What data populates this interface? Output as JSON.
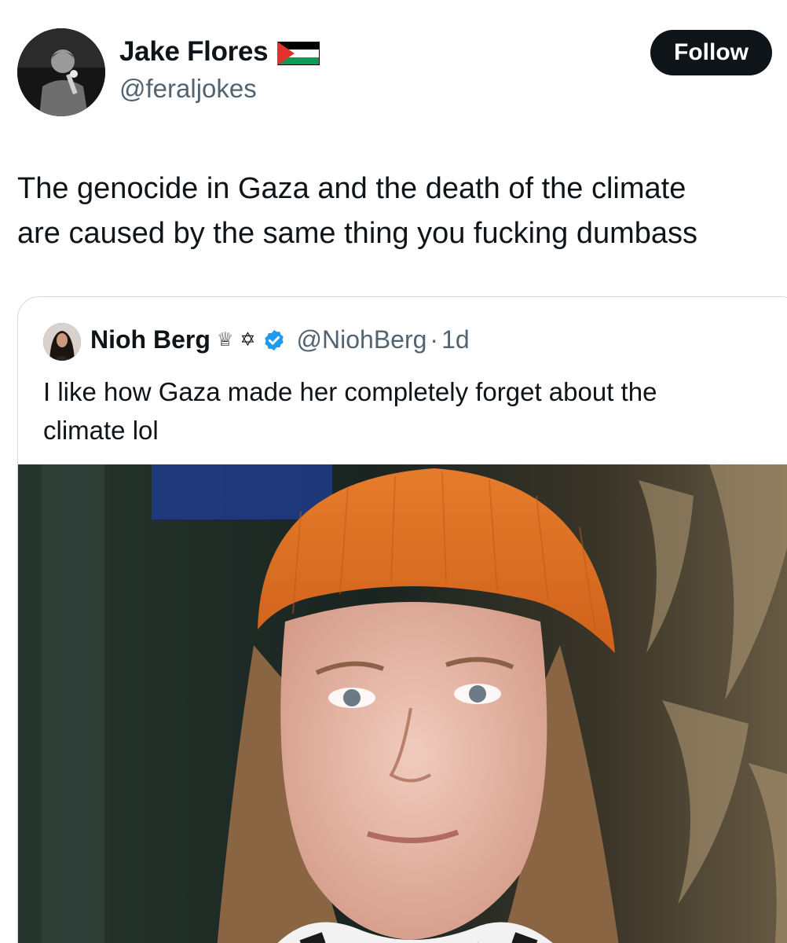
{
  "post": {
    "author": {
      "name": "Jake Flores",
      "handle": "@feraljokes",
      "flag_icon": "palestine-flag-icon"
    },
    "follow_label": "Follow",
    "text_lines": [
      "The genocide in Gaza and the death of the climate",
      "are caused by the same thing you fucking dumbass"
    ]
  },
  "quote": {
    "author": {
      "name": "Nioh Berg",
      "crown": "♕",
      "star": "✡",
      "handle": "@NiohBerg",
      "separator": "·",
      "time": "1d"
    },
    "text_lines": [
      "I like how Gaza made her completely forget about the",
      "climate lol"
    ],
    "image": "photo-person-orange-beanie"
  },
  "colors": {
    "text": "#0f1419",
    "secondary": "#536471",
    "follow_bg": "#0f1419",
    "verified": "#1d9bf0",
    "card_border": "#cfd9de",
    "beanie": "#e8731f"
  }
}
